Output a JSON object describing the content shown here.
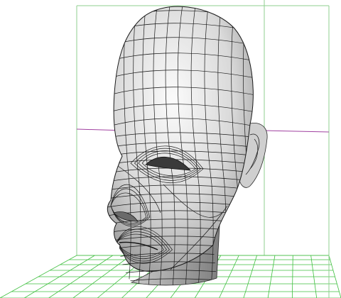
{
  "viewport": {
    "background": "#ffffff",
    "gizmo_color": "#7fbf7f",
    "axis_color": "#a040a0",
    "grid_color": "#3fbf3f",
    "mesh_shade_light": "#f4f4f4",
    "mesh_shade_dark": "#8a8a8a",
    "wire_color": "#1a1a1a"
  },
  "model": {
    "icon": "head-mesh-icon",
    "kind": "polygon-head-model"
  }
}
